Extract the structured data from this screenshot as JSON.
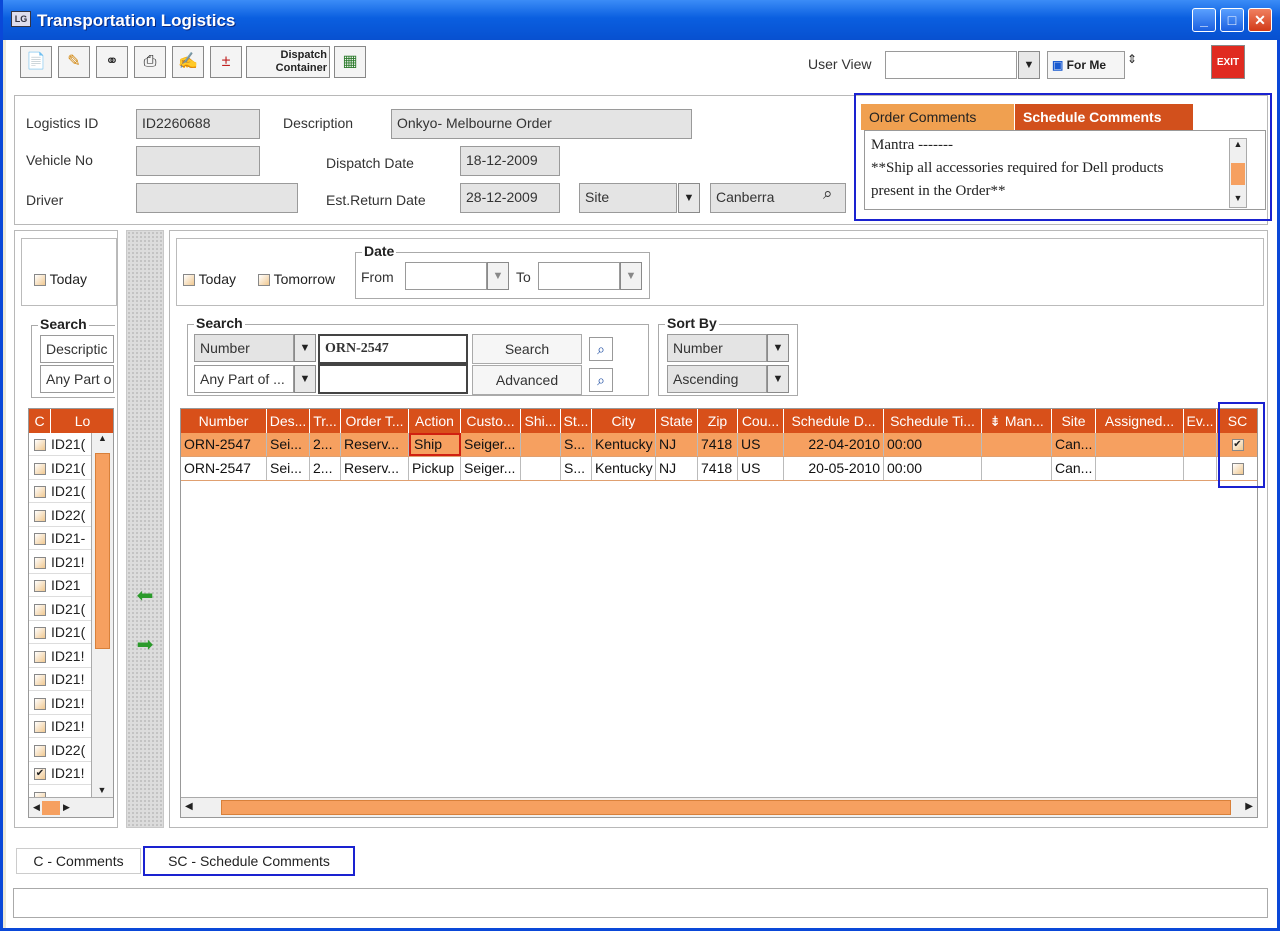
{
  "window": {
    "title": "Transportation Logistics",
    "min": "_",
    "max": "□",
    "close": "✕"
  },
  "toolbar": {
    "dispatch_line1": "Dispatch",
    "dispatch_line2": "Container",
    "user_view_label": "User View",
    "user_view_value": "",
    "for_me": "For Me",
    "exit": "EXIT"
  },
  "header": {
    "logistics_id_label": "Logistics ID",
    "logistics_id": "ID2260688",
    "description_label": "Description",
    "description": "Onkyo- Melbourne Order",
    "vehicle_label": "Vehicle No",
    "vehicle": "",
    "dispatch_date_label": "Dispatch Date",
    "dispatch_date": "18-12-2009",
    "driver_label": "Driver",
    "driver": "",
    "est_return_label": "Est.Return Date",
    "est_return": "28-12-2009",
    "site_select": "Site",
    "site_value": "Canberra"
  },
  "comments": {
    "tab_order": "Order Comments",
    "tab_schedule": "Schedule Comments",
    "line1": "Mantra -------",
    "line2": "**Ship all accessories required for Dell products",
    "line3": "present in the Order**"
  },
  "left": {
    "today": "Today",
    "search_title": "Search",
    "search_field": "Descriptic",
    "search_mode": "Any Part o",
    "col_c": "C",
    "col_lo": "Lo",
    "rows": [
      {
        "id": "ID21(",
        "checked": false
      },
      {
        "id": "ID21(",
        "checked": false
      },
      {
        "id": "ID21(",
        "checked": false
      },
      {
        "id": "ID22(",
        "checked": false
      },
      {
        "id": "ID21-",
        "checked": false
      },
      {
        "id": "ID21!",
        "checked": false
      },
      {
        "id": "ID21",
        "checked": false
      },
      {
        "id": "ID21(",
        "checked": false
      },
      {
        "id": "ID21(",
        "checked": false
      },
      {
        "id": "ID21!",
        "checked": false
      },
      {
        "id": "ID21!",
        "checked": false
      },
      {
        "id": "ID21!",
        "checked": false
      },
      {
        "id": "ID21!",
        "checked": false
      },
      {
        "id": "ID22(",
        "checked": false
      },
      {
        "id": "ID21!",
        "checked": true
      },
      {
        "id": "",
        "checked": false
      }
    ]
  },
  "filter": {
    "today": "Today",
    "tomorrow": "Tomorrow",
    "date_title": "Date",
    "from": "From",
    "to": "To"
  },
  "search": {
    "title": "Search",
    "field": "Number",
    "value": "ORN-2547",
    "mode": "Any Part of ...",
    "value2": "",
    "search_btn": "Search",
    "advanced_btn": "Advanced"
  },
  "sort": {
    "title": "Sort By",
    "field": "Number",
    "order": "Ascending"
  },
  "grid": {
    "columns": [
      "Number",
      "Des...",
      "Tr...",
      "Order T...",
      "Action",
      "Custo...",
      "Shi...",
      "St...",
      "City",
      "State",
      "Zip",
      "Cou...",
      "Schedule D...",
      "Schedule Ti...",
      "Man...",
      "Site",
      "Assigned...",
      "Ev...",
      "SC"
    ],
    "rows": [
      {
        "number": "ORN-2547",
        "des": "Sei...",
        "tr": "2...",
        "order": "Reserv...",
        "action": "Ship",
        "cust": "Seiger...",
        "shi": "",
        "st": "S...",
        "city": "Kentucky",
        "state": "NJ",
        "zip": "7418",
        "cou": "US",
        "sdate": "22-04-2010",
        "stime": "00:00",
        "man": "",
        "site": "Can...",
        "assigned": "",
        "ev": "",
        "sc": true
      },
      {
        "number": "ORN-2547",
        "des": "Sei...",
        "tr": "2...",
        "order": "Reserv...",
        "action": "Pickup",
        "cust": "Seiger...",
        "shi": "",
        "st": "S...",
        "city": "Kentucky",
        "state": "NJ",
        "zip": "7418",
        "cou": "US",
        "sdate": "20-05-2010",
        "stime": "00:00",
        "man": "",
        "site": "Can...",
        "assigned": "",
        "ev": "",
        "sc": false
      }
    ]
  },
  "legend": {
    "c": "C - Comments",
    "sc": "SC - Schedule Comments"
  },
  "colors": {
    "accent": "#d8501a",
    "row_highlight": "#f6a060",
    "callout": "#1a22d0"
  }
}
